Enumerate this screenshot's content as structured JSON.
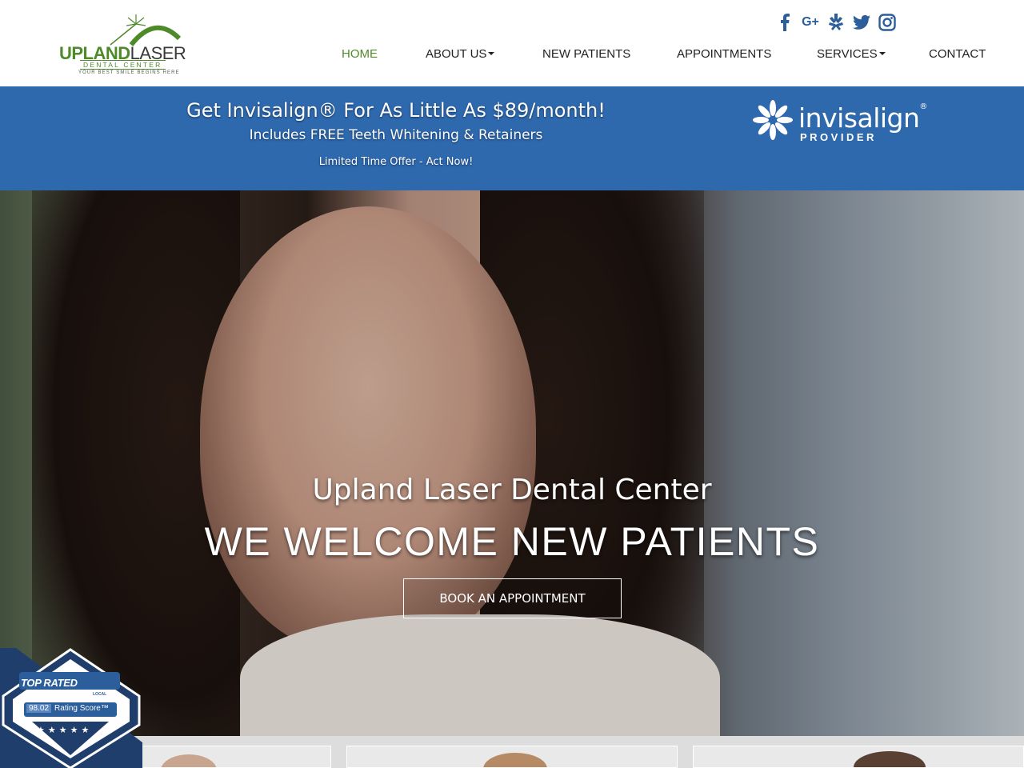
{
  "header": {
    "logo": {
      "upland": "UPLAND",
      "laser": "LASER",
      "subtitle": "DENTAL CENTER",
      "tagline": "YOUR BEST SMILE BEGINS HERE"
    },
    "social": [
      {
        "name": "facebook-icon",
        "glyph": "f"
      },
      {
        "name": "google-plus-icon",
        "glyph": "G+"
      },
      {
        "name": "yelp-icon",
        "glyph": "✻"
      },
      {
        "name": "twitter-icon",
        "glyph": "🐦"
      },
      {
        "name": "instagram-icon",
        "glyph": "◎"
      }
    ],
    "nav": {
      "home": "HOME",
      "about": "ABOUT US",
      "new_patients": "NEW PATIENTS",
      "appointments": "APPOINTMENTS",
      "services": "SERVICES",
      "contact": "CONTACT"
    }
  },
  "promo": {
    "title": "Get Invisalign® For As Little As $89/month!",
    "subtitle": "Includes FREE Teeth Whitening & Retainers",
    "note": "Limited Time Offer - Act Now!",
    "invisalign_logo": {
      "word": "invisalign",
      "registered": "®",
      "sub": "PROVIDER"
    }
  },
  "hero": {
    "subtitle": "Upland Laser Dental Center",
    "title": "WE WELCOME NEW PATIENTS",
    "button": "BOOK AN APPOINTMENT"
  },
  "badge": {
    "label": "TOP RATED",
    "local": "LOCAL",
    "score": "98.02",
    "score_label": "Rating Score™",
    "stars": "★★★★★"
  },
  "colors": {
    "brand_green": "#4f8a2a",
    "promo_blue": "#2e68ad",
    "social_blue": "#2c5e9b",
    "badge_navy": "#1f3e6b"
  }
}
